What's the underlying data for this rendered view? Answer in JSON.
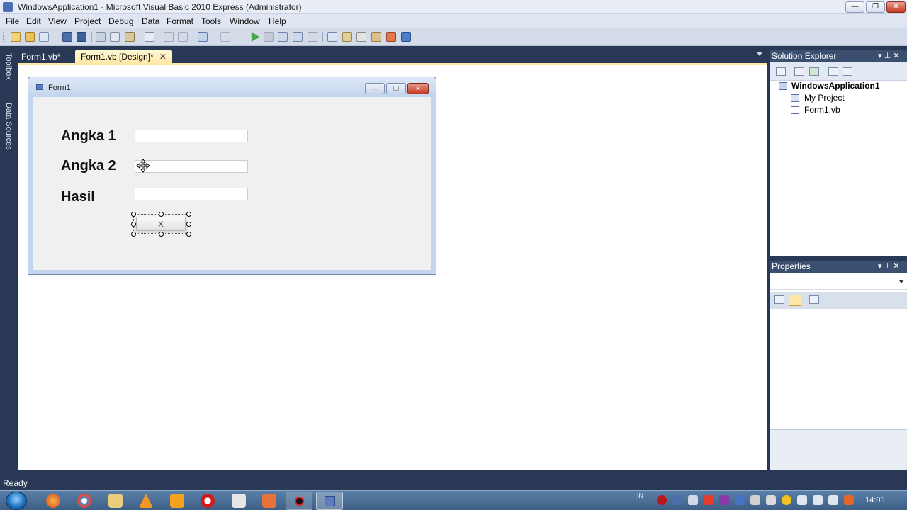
{
  "window": {
    "title": "WindowsApplication1 - Microsoft Visual Basic 2010 Express (Administrator)",
    "minimize": "—",
    "restore": "❐",
    "close": "✕"
  },
  "menu": [
    "File",
    "Edit",
    "View",
    "Project",
    "Debug",
    "Data",
    "Format",
    "Tools",
    "Window",
    "Help"
  ],
  "side_tabs": {
    "toolbox": "Toolbox",
    "data_sources": "Data Sources"
  },
  "doc_tabs": [
    {
      "label": "Form1.vb*",
      "active": false
    },
    {
      "label": "Form1.vb [Design]*",
      "active": true,
      "close": "✕"
    }
  ],
  "form": {
    "title": "Form1",
    "minimize": "—",
    "restore": "❐",
    "close": "✕",
    "labels": {
      "angka1": "Angka 1",
      "angka2": "Angka 2",
      "hasil": "Hasil"
    },
    "button": {
      "text": "X"
    }
  },
  "solution_explorer": {
    "title": "Solution Explorer",
    "pin": "▾ ⊥ ✕",
    "tree": {
      "solution": "WindowsApplication1",
      "my_project": "My Project",
      "form1": "Form1.vb"
    }
  },
  "properties": {
    "title": "Properties",
    "pin": "▾ ⊥ ✕"
  },
  "status": {
    "text": "Ready"
  },
  "taskbar": {
    "lang": "IN",
    "clock": "14:05"
  },
  "colors": {
    "ide_background": "#293955",
    "active_tab": "#ffe8a6",
    "panel_header": "#3b4f71"
  }
}
